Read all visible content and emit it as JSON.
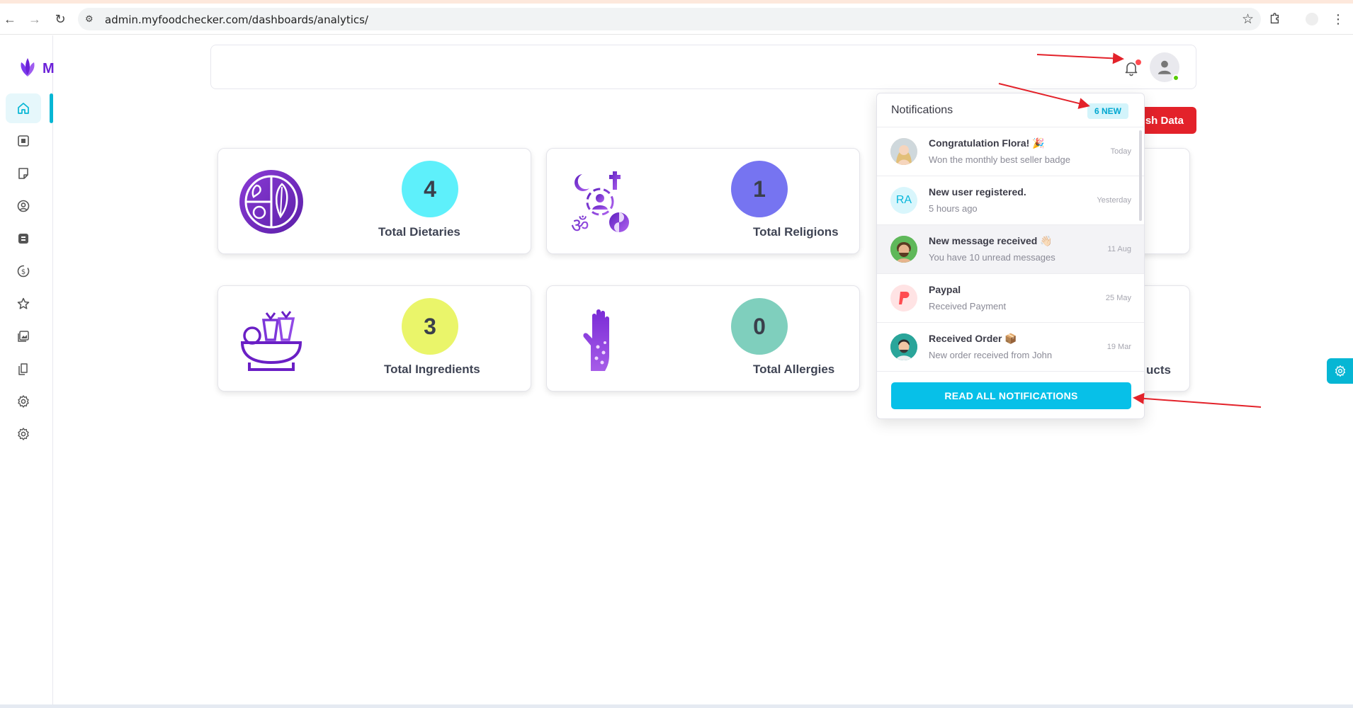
{
  "browser": {
    "url": "admin.myfoodchecker.com/dashboards/analytics/"
  },
  "logo": {
    "letter": "M"
  },
  "header": {
    "refresh_label": "sh Data"
  },
  "cards": [
    {
      "count": "4",
      "label": "Total Dietaries",
      "color": "#5ef0fb"
    },
    {
      "count": "1",
      "label": "Total Religions",
      "color": "#7674f1"
    },
    {
      "count": "3",
      "label": "Total Ingredients",
      "color": "#eaf56a"
    },
    {
      "count": "0",
      "label": "Total Allergies",
      "color": "#7fcfbd"
    }
  ],
  "partial_card_label": "ucts",
  "notifications": {
    "title": "Notifications",
    "badge": "6 NEW",
    "items": [
      {
        "title": "Congratulation Flora! 🎉",
        "subtitle": "Won the monthly best seller badge",
        "time": "Today"
      },
      {
        "title": "New user registered.",
        "subtitle": "5 hours ago",
        "time": "Yesterday",
        "initials": "RA"
      },
      {
        "title": "New message received 👋🏻",
        "subtitle": "You have 10 unread messages",
        "time": "11 Aug"
      },
      {
        "title": "Paypal",
        "subtitle": "Received Payment",
        "time": "25 May"
      },
      {
        "title": "Received Order 📦",
        "subtitle": "New order received from John",
        "time": "19 Mar"
      }
    ],
    "read_all_label": "READ ALL NOTIFICATIONS"
  },
  "colors": {
    "accent": "#06b6d4",
    "danger": "#e3222a",
    "brand": "#6b21d8"
  }
}
